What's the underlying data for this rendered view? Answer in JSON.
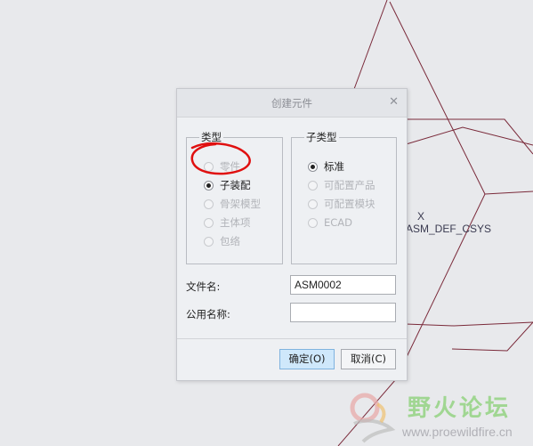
{
  "background": {
    "color": "#e8e9ec",
    "csys_axis": "X",
    "csys_label": "ASM_DEF_CSYS",
    "line_color": "#7a2a3a"
  },
  "dialog": {
    "title": "创建元件",
    "close_icon": "close-icon",
    "type_group": {
      "legend": "类型",
      "options": [
        {
          "label": "零件",
          "selected": false,
          "enabled": false
        },
        {
          "label": "子装配",
          "selected": true,
          "enabled": true
        },
        {
          "label": "骨架模型",
          "selected": false,
          "enabled": false
        },
        {
          "label": "主体项",
          "selected": false,
          "enabled": false
        },
        {
          "label": "包络",
          "selected": false,
          "enabled": false
        }
      ]
    },
    "subtype_group": {
      "legend": "子类型",
      "options": [
        {
          "label": "标准",
          "selected": true,
          "enabled": true
        },
        {
          "label": "可配置产品",
          "selected": false,
          "enabled": false
        },
        {
          "label": "可配置模块",
          "selected": false,
          "enabled": false
        },
        {
          "label": "ECAD",
          "selected": false,
          "enabled": false
        }
      ]
    },
    "file_name": {
      "label": "文件名:",
      "value": "ASM0002"
    },
    "common_name": {
      "label": "公用名称:",
      "value": ""
    },
    "ok_label": "确定(O)",
    "cancel_label": "取消(C)"
  },
  "annotation": {
    "color": "#e01010"
  },
  "watermark": {
    "text": "野火论坛",
    "url": "www.proewildfire.cn",
    "logo_icon": "forum-logo-icon"
  }
}
